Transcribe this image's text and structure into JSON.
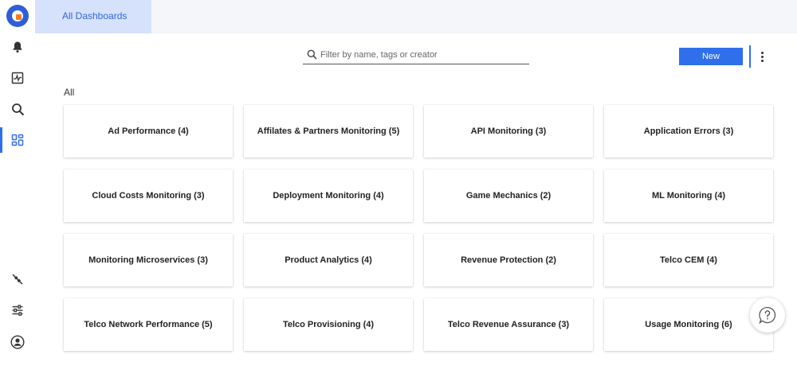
{
  "header": {
    "tab_label": "All Dashboards"
  },
  "search": {
    "placeholder": "Filter by name, tags or creator",
    "value": ""
  },
  "toolbar": {
    "new_label": "New"
  },
  "section": {
    "label": "All"
  },
  "sidebar": {
    "items": [
      {
        "name": "notifications",
        "icon": "bell-icon"
      },
      {
        "name": "monitors",
        "icon": "activity-icon"
      },
      {
        "name": "explore",
        "icon": "search-icon"
      },
      {
        "name": "dashboards",
        "icon": "dashboard-grid-icon",
        "active": true
      },
      {
        "name": "integrations",
        "icon": "plug-icon"
      },
      {
        "name": "settings",
        "icon": "sliders-icon"
      },
      {
        "name": "profile",
        "icon": "user-icon"
      }
    ]
  },
  "dashboards": [
    "Ad Performance (4)",
    "Affilates & Partners Monitoring (5)",
    "API Monitoring (3)",
    "Application Errors (3)",
    "Cloud Costs Monitoring (3)",
    "Deployment Monitoring (4)",
    "Game Mechanics (2)",
    "ML Monitoring (4)",
    "Monitoring Microservices (3)",
    "Product Analytics (4)",
    "Revenue Protection (2)",
    "Telco CEM (4)",
    "Telco Network Performance (5)",
    "Telco Provisioning (4)",
    "Telco Revenue Assurance (3)",
    "Usage Monitoring (6)"
  ],
  "colors": {
    "accent": "#2f6fec",
    "tab_bg": "#d6e2fb",
    "brand": "#2c5fd8",
    "brand_dot": "#ff7a1a"
  }
}
